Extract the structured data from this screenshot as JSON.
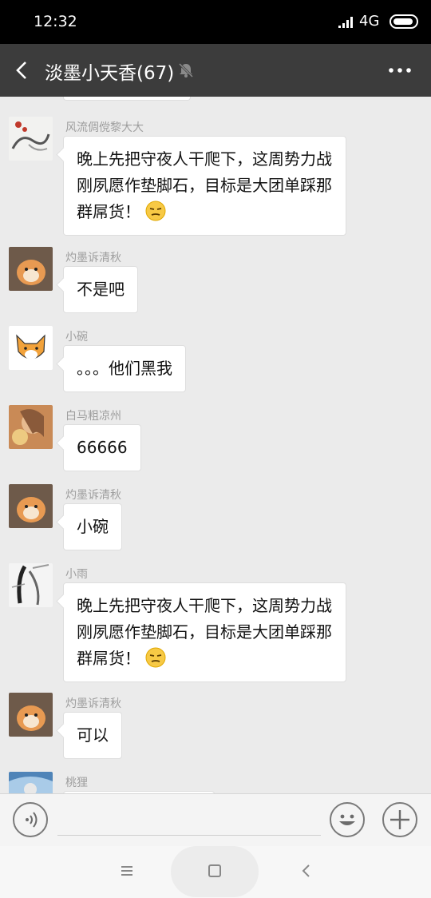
{
  "status": {
    "time": "12:32",
    "network": "4G"
  },
  "header": {
    "title": "淡墨小天香(67)"
  },
  "messages": [
    {
      "sender": "风流倜傥黎大大",
      "text": "晚上先把守夜人干爬下，这周势力战刚夙愿作垫脚石，目标是大团单踩那群屌货！",
      "emoji": "unamused-emoji"
    },
    {
      "sender": "灼墨诉清秋",
      "text": "不是吧"
    },
    {
      "sender": "小碗",
      "text": "。。。他们黑我"
    },
    {
      "sender": "白马粗凉州",
      "text": "66666"
    },
    {
      "sender": "灼墨诉清秋",
      "text": "小碗"
    },
    {
      "sender": "小雨",
      "text": "晚上先把守夜人干爬下，这周势力战刚夙愿作垫脚石，目标是大团单踩那群屌货！",
      "emoji": "unamused-emoji"
    },
    {
      "sender": "灼墨诉清秋",
      "text": "可以"
    },
    {
      "sender": "桃狸"
    }
  ],
  "colors": {
    "header_bg": "#3c3c3c",
    "chat_bg": "#ebebeb",
    "bubble_bg": "#ffffff"
  },
  "icons": {
    "back": "back-arrow-icon",
    "mute": "mute-bell-icon",
    "more": "more-dots-icon",
    "voice": "voice-icon",
    "emoji": "emoji-icon",
    "plus": "plus-icon"
  }
}
